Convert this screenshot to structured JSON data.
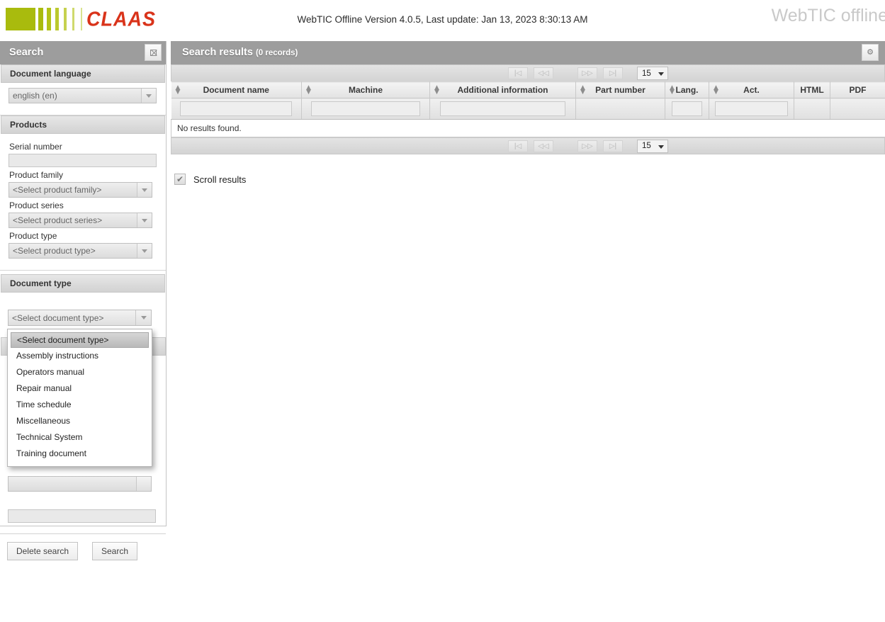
{
  "header": {
    "brand": "CLAAS",
    "center_text": "WebTIC Offline Version 4.0.5, Last update: Jan 13, 2023 8:30:13 AM",
    "right_text": "WebTIC offline"
  },
  "search_panel": {
    "title": "Search",
    "toggle_icon": "collapse-panel-icon",
    "sections": {
      "document_language": {
        "title": "Document language",
        "value": "english (en)"
      },
      "products": {
        "title": "Products",
        "serial_number_label": "Serial number",
        "serial_number_value": "",
        "product_family_label": "Product family",
        "product_family_value": "<Select product family>",
        "product_series_label": "Product series",
        "product_series_value": "<Select product series>",
        "product_type_label": "Product type",
        "product_type_value": "<Select product type>"
      },
      "document_type": {
        "title": "Document type",
        "value": "<Select document type>",
        "options": [
          "<Select document type>",
          "Assembly instructions",
          "Operators manual",
          "Repair manual",
          "Time schedule",
          "Miscellaneous",
          "Technical System",
          "Training document"
        ],
        "selected_index": 0
      }
    },
    "bottom_input_value": "",
    "buttons": {
      "delete": "Delete search",
      "search": "Search"
    }
  },
  "results": {
    "title": "Search results",
    "count_text": "(0 records)",
    "gear_icon": "gear-icon",
    "pager": {
      "first": "|◁",
      "prev": "◁◁",
      "next": "▷▷",
      "last": "▷|",
      "page_size": "15"
    },
    "columns": [
      {
        "label": "Document name",
        "sortable": true,
        "filter": true
      },
      {
        "label": "Machine",
        "sortable": true,
        "filter": true
      },
      {
        "label": "Additional information",
        "sortable": true,
        "filter": true
      },
      {
        "label": "Part number",
        "sortable": true,
        "filter": false
      },
      {
        "label": "Lang.",
        "sortable": true,
        "filter": true
      },
      {
        "label": "Act.",
        "sortable": true,
        "filter": true
      },
      {
        "label": "HTML",
        "sortable": false,
        "filter": false
      },
      {
        "label": "PDF",
        "sortable": false,
        "filter": false
      }
    ],
    "empty_message": "No results found.",
    "scroll_results_label": "Scroll results",
    "scroll_results_checked": true
  },
  "colors": {
    "brand_red": "#d9331a",
    "brand_green": "#a9bb0d",
    "title_bar_gray": "#9d9d9d",
    "panel_gray": "#d2d2d2"
  }
}
